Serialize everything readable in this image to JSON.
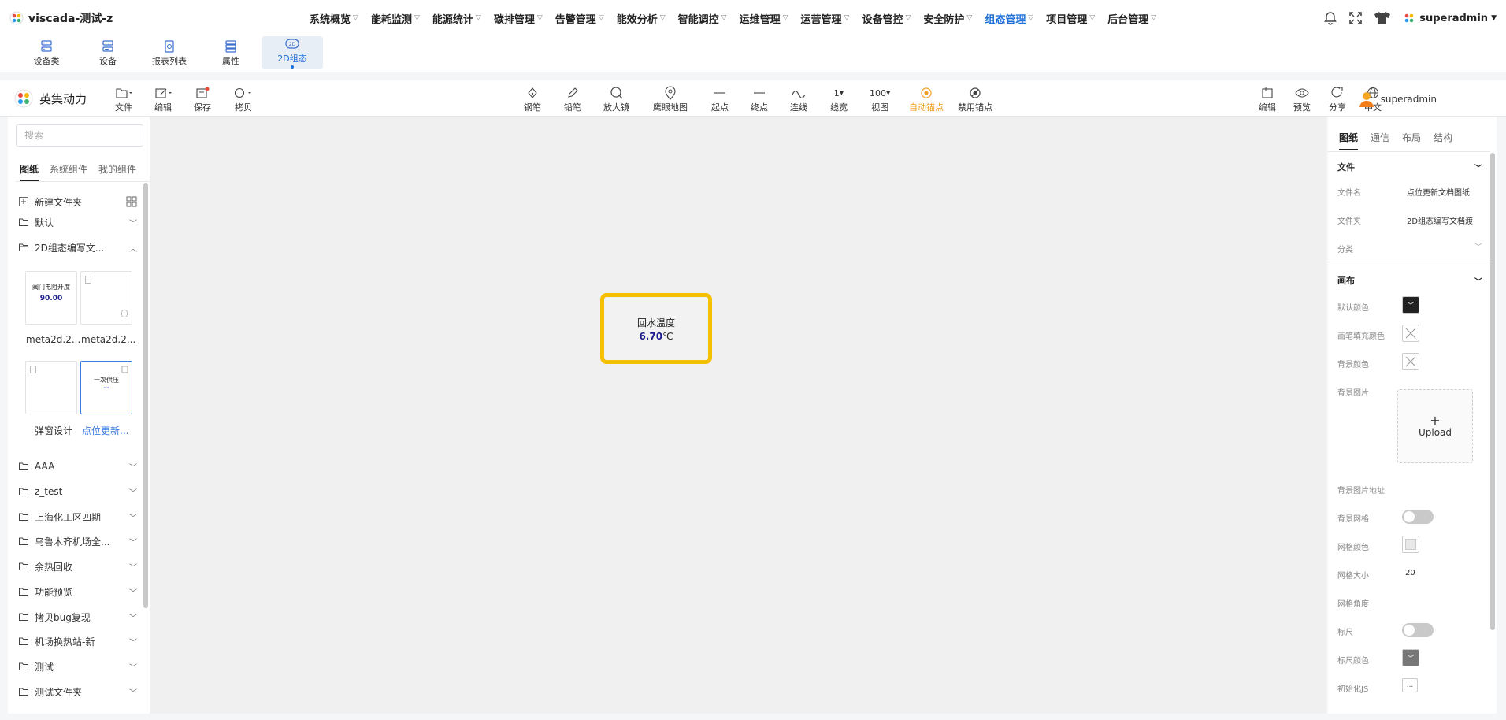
{
  "app": {
    "title": "viscada-测试-z",
    "user": "superadmin"
  },
  "nav": {
    "items": [
      {
        "label": "系统概览"
      },
      {
        "label": "能耗监测"
      },
      {
        "label": "能源统计"
      },
      {
        "label": "碳排管理"
      },
      {
        "label": "告警管理"
      },
      {
        "label": "能效分析"
      },
      {
        "label": "智能调控"
      },
      {
        "label": "运维管理"
      },
      {
        "label": "运营管理"
      },
      {
        "label": "设备管控"
      },
      {
        "label": "安全防护"
      },
      {
        "label": "组态管理"
      },
      {
        "label": "项目管理"
      },
      {
        "label": "后台管理"
      }
    ],
    "active": "组态管理"
  },
  "subtabs": [
    {
      "label": "设备类"
    },
    {
      "label": "设备"
    },
    {
      "label": "报表列表"
    },
    {
      "label": "属性"
    },
    {
      "label": "2D组态"
    }
  ],
  "editor": {
    "brand": "英集动力",
    "user": "superadmin",
    "left_tools": [
      {
        "label": "文件"
      },
      {
        "label": "编辑"
      },
      {
        "label": "保存"
      },
      {
        "label": "拷贝"
      }
    ],
    "center_tools": [
      {
        "label": "钢笔"
      },
      {
        "label": "铅笔"
      },
      {
        "label": "放大镜"
      },
      {
        "label": "鹰眼地图"
      },
      {
        "label": "起点"
      },
      {
        "label": "终点"
      },
      {
        "label": "连线"
      },
      {
        "label": "线宽",
        "value": "1"
      },
      {
        "label": "视图",
        "value": "100"
      },
      {
        "label": "自动锚点"
      },
      {
        "label": "禁用锚点"
      }
    ],
    "right_tools": [
      {
        "label": "编辑"
      },
      {
        "label": "预览"
      },
      {
        "label": "分享"
      },
      {
        "label": "中文"
      }
    ]
  },
  "left_panel": {
    "search_placeholder": "搜索",
    "tabs": [
      {
        "label": "图纸"
      },
      {
        "label": "系统组件"
      },
      {
        "label": "我的组件"
      }
    ],
    "new_folder": "新建文件夹",
    "folders_top": [
      {
        "label": "默认"
      },
      {
        "label": "2D组态编写文..."
      }
    ],
    "thumbs": [
      {
        "caption": "meta2d.2...",
        "text": "阀门电阻开度",
        "num": "90.00"
      },
      {
        "caption": "meta2d.2..."
      },
      {
        "caption": "弹窗设计"
      },
      {
        "caption": "点位更新...",
        "text": "一次供压",
        "num": "--"
      }
    ],
    "folders": [
      {
        "label": "AAA"
      },
      {
        "label": "z_test"
      },
      {
        "label": "上海化工区四期"
      },
      {
        "label": "乌鲁木齐机场全..."
      },
      {
        "label": "余热回收"
      },
      {
        "label": "功能预览"
      },
      {
        "label": "拷贝bug复现"
      },
      {
        "label": "机场换热站-新"
      },
      {
        "label": "测试"
      },
      {
        "label": "测试文件夹"
      }
    ]
  },
  "canvas": {
    "widget": {
      "title": "回水温度",
      "value": "6.70",
      "unit": "℃"
    }
  },
  "right_panel": {
    "tabs": [
      {
        "label": "图纸"
      },
      {
        "label": "通信"
      },
      {
        "label": "布局"
      },
      {
        "label": "结构"
      }
    ],
    "file": {
      "head": "文件",
      "name_label": "文件名",
      "name_value": "点位更新文档图纸",
      "folder_label": "文件夹",
      "folder_value": "2D组态编写文档渡",
      "category_label": "分类"
    },
    "canvas_props": {
      "head": "画布",
      "default_color": "默认颜色",
      "pen_fill": "画笔填充颜色",
      "bg_color": "背景颜色",
      "bg_image": "背景图片",
      "upload": "Upload",
      "bg_image_url": "背景图片地址",
      "bg_grid": "背景网格",
      "grid_color": "网格颜色",
      "grid_size": "网格大小",
      "grid_size_value": "20",
      "grid_angle": "网格角度",
      "ruler": "标尺",
      "ruler_color": "标尺颜色",
      "init_js": "初始化JS",
      "init_js_btn": "..."
    }
  },
  "colors": {
    "accent": "#1e6fd9",
    "widget_border": "#f5c000",
    "orange": "#f0a020"
  }
}
